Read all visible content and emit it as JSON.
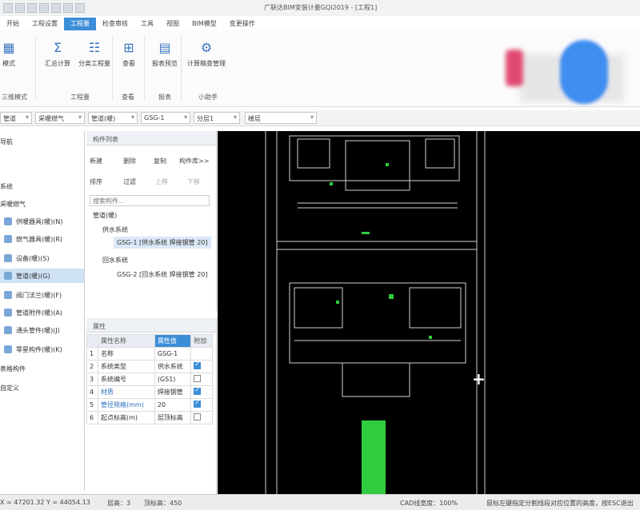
{
  "window": {
    "title": "广联达BIM安装计量GQI2019 - [工程1]"
  },
  "ribbon_tabs": [
    "开始",
    "工程设置",
    "工程量",
    "检查审核",
    "工具",
    "视图",
    "BIM模型",
    "变更操作"
  ],
  "ribbon": {
    "buttons": {
      "mode": "模式",
      "sum": "汇总计算",
      "sub": "分类工程量",
      "check": "查看",
      "report": "报表预览",
      "calc": "计算稿查管理"
    },
    "groups": [
      "三维模式",
      "工程量",
      "查看",
      "报表",
      "小助手"
    ]
  },
  "filters": [
    "管道",
    "采暖燃气",
    "管道(暖)",
    "GSG-1",
    "分层1",
    "楼层"
  ],
  "nav": {
    "head": "导航",
    "items": [
      "系统",
      "采暖燃气",
      "供暖器具(暖)(N)",
      "燃气器具(暖)(R)",
      "设备(暖)(S)",
      "管道(暖)(G)",
      "阀门法兰(暖)(F)",
      "管道附件(暖)(A)",
      "通头管件(暖)(J)",
      "零星构件(暖)(K)",
      "表格构件",
      "自定义"
    ]
  },
  "complist": {
    "title": "构件列表",
    "toolbar": [
      "新建",
      "删除",
      "复制",
      "构件库>>",
      "排序",
      "过滤",
      "上移",
      "下移"
    ],
    "search_placeholder": "搜索构件...",
    "tree": [
      "管道(暖)",
      "供水系统",
      "GSG-1 [供水系统 焊接钢管 20]",
      "回水系统",
      "GSG-2 [回水系统 焊接钢管 20]"
    ]
  },
  "props": {
    "title": "属性",
    "headers": [
      "属性名称",
      "属性值",
      "附加"
    ],
    "rows": [
      {
        "n": "1",
        "name": "名称",
        "value": "GSG-1",
        "chk": false
      },
      {
        "n": "2",
        "name": "系统类型",
        "value": "供水系统",
        "chk": true
      },
      {
        "n": "3",
        "name": "系统编号",
        "value": "(GS1)",
        "chk": false
      },
      {
        "n": "4",
        "name": "材质",
        "value": "焊接钢管",
        "chk": true
      },
      {
        "n": "5",
        "name": "管径规格(mm)",
        "value": "20",
        "chk": true
      },
      {
        "n": "6",
        "name": "起点标高(m)",
        "value": "层顶标高",
        "chk": false
      }
    ]
  },
  "status": {
    "coords": "X = 47201.32 Y = 44054.13",
    "layer": "层高：3",
    "elev": "顶标高：450",
    "cad": "CAD线宽度：100%",
    "hint": "鼠标左键指定分割线段对应位置的高度，按ESC退出"
  }
}
